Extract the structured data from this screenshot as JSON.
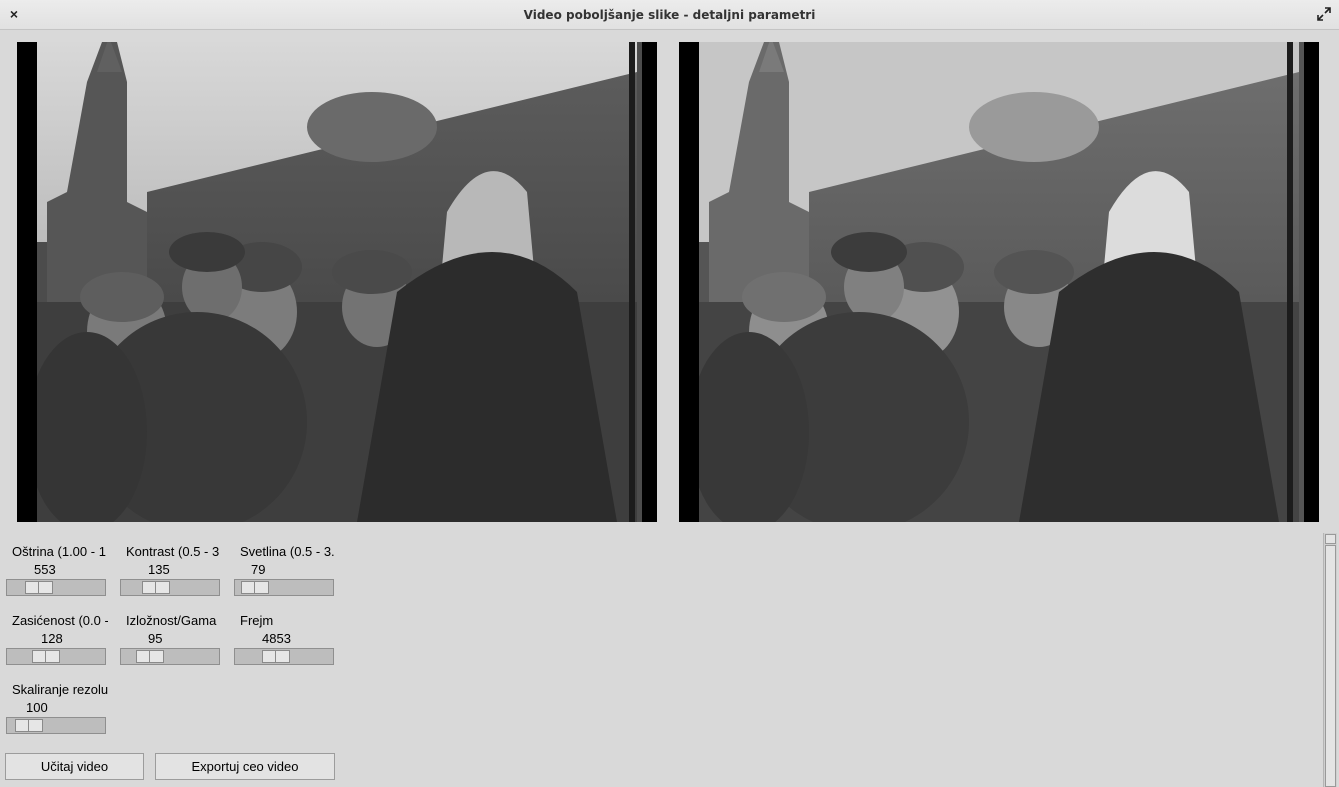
{
  "window": {
    "title": "Video poboljšanje slike - detaljni parametri",
    "close_glyph": "×"
  },
  "icons": {
    "close": "close-icon",
    "maximize": "maximize-icon"
  },
  "videos": {
    "original": "video-original",
    "enhanced": "video-enhanced"
  },
  "sliders": [
    {
      "label": "Oštrina (1.00 - 1",
      "value": "553",
      "level": 0.25
    },
    {
      "label": "Kontrast (0.5 - 3",
      "value": "135",
      "level": 0.3
    },
    {
      "label": "Svetlina (0.5 - 3.",
      "value": "79",
      "level": 0.08
    },
    {
      "label": "Zasićenost (0.0 -",
      "value": "128",
      "level": 0.35
    },
    {
      "label": "Izložnost/Gama",
      "value": "95",
      "level": 0.22
    },
    {
      "label": "Frejm",
      "value": "4853",
      "level": 0.39
    },
    {
      "label": "Skaliranje rezolu",
      "value": "100",
      "level": 0.12
    }
  ],
  "buttons": {
    "load": "Učitaj video",
    "export": "Exportuj ceo video"
  },
  "colors": {
    "background": "#d9d9d9",
    "trough": "#bdbdbd"
  }
}
